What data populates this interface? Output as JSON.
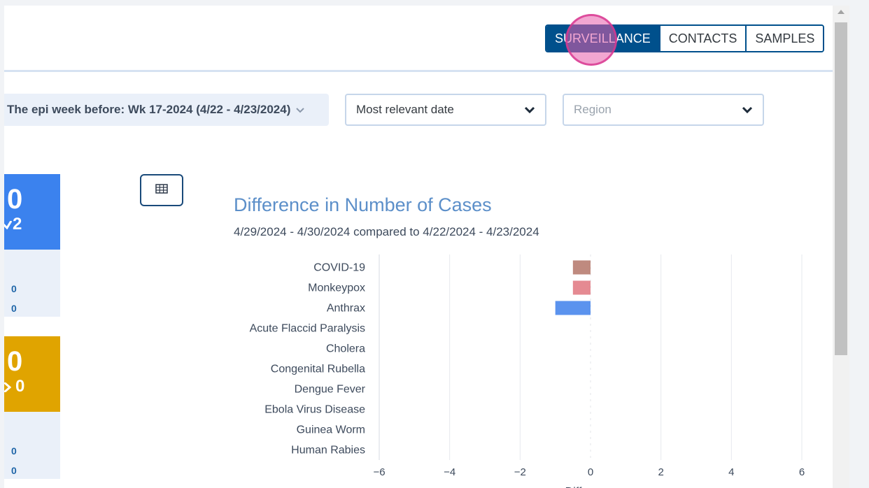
{
  "header": {
    "view_tabs": [
      {
        "label": "SURVEILLANCE",
        "active": true
      },
      {
        "label": "CONTACTS",
        "active": false
      },
      {
        "label": "SAMPLES",
        "active": false
      }
    ]
  },
  "filters": {
    "epi_week": "The epi week before: Wk 17-2024 (4/22 - 4/23/2024)",
    "date_type": "Most relevant date",
    "region_placeholder": "Region"
  },
  "cards": {
    "blue": {
      "value": "0",
      "change": "2"
    },
    "blue_rows": [
      "0",
      "0"
    ],
    "yellow": {
      "value": "0",
      "change": "0"
    },
    "yellow_rows": [
      "0",
      "0"
    ]
  },
  "colors": {
    "primary": "#00508c",
    "blue_card": "#3b82ee",
    "yellow_card": "#e0a400",
    "title": "#5c8fc9"
  },
  "icons": {
    "table": "table-icon",
    "chevron": "chevron-down-icon"
  },
  "chart_data": {
    "type": "bar",
    "orientation": "horizontal",
    "title": "Difference in Number of Cases",
    "subtitle": "4/29/2024 - 4/30/2024 compared to 4/22/2024 - 4/23/2024",
    "categories": [
      "COVID-19",
      "Monkeypox",
      "Anthrax",
      "Acute Flaccid Paralysis",
      "Cholera",
      "Congenital Rubella",
      "Dengue Fever",
      "Ebola Virus Disease",
      "Guinea Worm",
      "Human Rabies"
    ],
    "values": [
      -0.5,
      -0.5,
      -1,
      0,
      0,
      0,
      0,
      0,
      0,
      0
    ],
    "bar_colors": [
      "#bf8a7f",
      "#e58a92",
      "#5b93ee",
      null,
      null,
      null,
      null,
      null,
      null,
      null
    ],
    "xlim": [
      -6,
      6
    ],
    "xticks": [
      -6,
      -4,
      -2,
      0,
      2,
      4,
      6
    ],
    "xlabel": "Difference",
    "grid": true
  }
}
